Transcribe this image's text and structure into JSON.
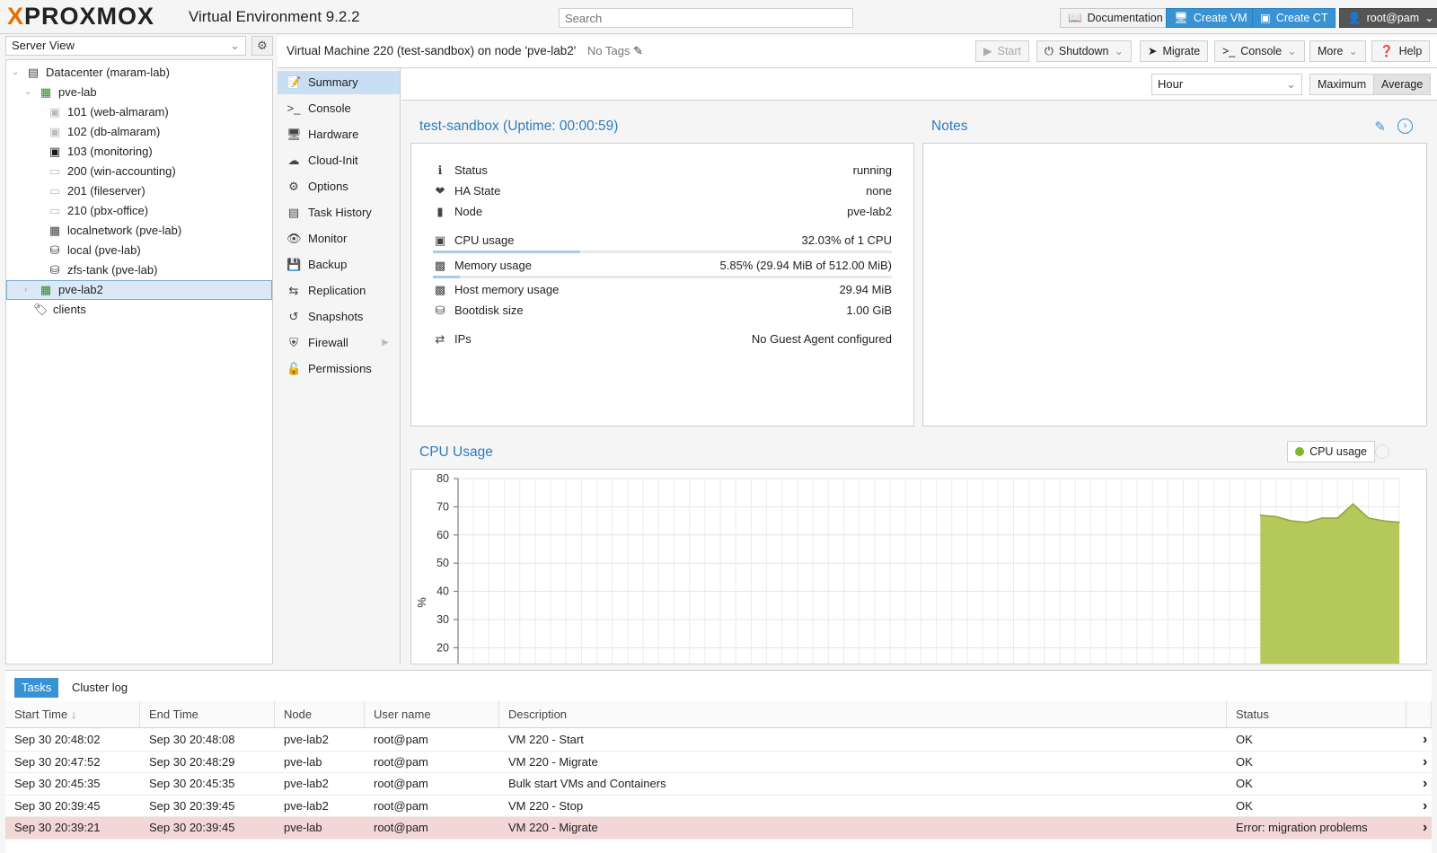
{
  "header": {
    "logo_prefix": "X",
    "logo_text": "PROXMOX",
    "version": "Virtual Environment 9.2.2",
    "search_placeholder": "Search",
    "buttons": {
      "documentation": "Documentation",
      "create_vm": "Create VM",
      "create_ct": "Create CT",
      "user": "root@pam"
    }
  },
  "sidebar": {
    "view_select": "Server View",
    "tree": [
      {
        "label": "Datacenter (maram-lab)",
        "icon": "datacenter-icon"
      },
      {
        "label": "pve-lab",
        "icon": "node-online-icon"
      },
      {
        "label": "101 (web-almaram)",
        "icon": "container-stopped-icon"
      },
      {
        "label": "102 (db-almaram)",
        "icon": "container-stopped-icon"
      },
      {
        "label": "103 (monitoring)",
        "icon": "container-running-icon"
      },
      {
        "label": "200 (win-accounting)",
        "icon": "vm-stopped-icon"
      },
      {
        "label": "201 (fileserver)",
        "icon": "vm-stopped-icon"
      },
      {
        "label": "210 (pbx-office)",
        "icon": "vm-stopped-icon"
      },
      {
        "label": "localnetwork (pve-lab)",
        "icon": "network-grid-icon"
      },
      {
        "label": "local (pve-lab)",
        "icon": "storage-icon"
      },
      {
        "label": "zfs-tank (pve-lab)",
        "icon": "storage-icon"
      },
      {
        "label": "pve-lab2",
        "icon": "node-online-icon"
      },
      {
        "label": "clients",
        "icon": "tags-icon"
      }
    ]
  },
  "titlebar": {
    "title": "Virtual Machine 220 (test-sandbox) on node 'pve-lab2'",
    "tags": "No Tags",
    "buttons": {
      "start": "Start",
      "shutdown": "Shutdown",
      "migrate": "Migrate",
      "console": "Console",
      "more": "More",
      "help": "Help"
    }
  },
  "nav": [
    {
      "label": "Summary",
      "icon": "summary-icon"
    },
    {
      "label": "Console",
      "icon": "console-icon"
    },
    {
      "label": "Hardware",
      "icon": "hardware-icon"
    },
    {
      "label": "Cloud-Init",
      "icon": "cloud-icon"
    },
    {
      "label": "Options",
      "icon": "options-gear-icon"
    },
    {
      "label": "Task History",
      "icon": "task-history-icon"
    },
    {
      "label": "Monitor",
      "icon": "monitor-eye-icon"
    },
    {
      "label": "Backup",
      "icon": "backup-floppy-icon"
    },
    {
      "label": "Replication",
      "icon": "replication-icon"
    },
    {
      "label": "Snapshots",
      "icon": "snapshots-icon"
    },
    {
      "label": "Firewall",
      "icon": "firewall-shield-icon"
    },
    {
      "label": "Permissions",
      "icon": "permissions-unlock-icon"
    }
  ],
  "toolbar2": {
    "timeframe": "Hour",
    "maximum": "Maximum",
    "average": "Average"
  },
  "summary": {
    "title": "test-sandbox (Uptime: 00:00:59)",
    "rows": {
      "status": {
        "label": "Status",
        "value": "running"
      },
      "ha": {
        "label": "HA State",
        "value": "none"
      },
      "node": {
        "label": "Node",
        "value": "pve-lab2"
      },
      "cpu": {
        "label": "CPU usage",
        "value": "32.03% of 1 CPU"
      },
      "mem": {
        "label": "Memory usage",
        "value": "5.85% (29.94 MiB of 512.00 MiB)"
      },
      "hostmem": {
        "label": "Host memory usage",
        "value": "29.94 MiB"
      },
      "bootdisk": {
        "label": "Bootdisk size",
        "value": "1.00 GiB"
      },
      "ips": {
        "label": "IPs",
        "value": "No Guest Agent configured"
      }
    },
    "cpu_fraction": 0.3203,
    "mem_fraction": 0.0585
  },
  "notes": {
    "title": "Notes"
  },
  "chart_data": {
    "type": "area",
    "title": "CPU Usage",
    "ylabel": "%",
    "ylim": [
      20,
      80
    ],
    "yticks": [
      "80",
      "70",
      "60",
      "50",
      "40",
      "30",
      "20"
    ],
    "legend": "CPU usage",
    "legend_position": "top-right",
    "grid": true,
    "color": "#b5c95a",
    "series": [
      {
        "name": "CPU usage",
        "x": [
          52,
          53,
          54,
          55,
          56,
          57,
          58,
          59,
          60,
          61
        ],
        "values": [
          67,
          66.5,
          65,
          64.5,
          66,
          66,
          71,
          66,
          65,
          64.5
        ]
      }
    ],
    "xlim": [
      0,
      61
    ]
  },
  "bottom": {
    "tabs": {
      "tasks": "Tasks",
      "cluster_log": "Cluster log"
    },
    "columns": [
      "Start Time",
      "End Time",
      "Node",
      "User name",
      "Description",
      "Status"
    ],
    "rows": [
      {
        "start": "Sep 30 20:48:02",
        "end": "Sep 30 20:48:08",
        "node": "pve-lab2",
        "user": "root@pam",
        "desc": "VM 220 - Start",
        "status": "OK"
      },
      {
        "start": "Sep 30 20:47:52",
        "end": "Sep 30 20:48:29",
        "node": "pve-lab",
        "user": "root@pam",
        "desc": "VM 220 - Migrate",
        "status": "OK"
      },
      {
        "start": "Sep 30 20:45:35",
        "end": "Sep 30 20:45:35",
        "node": "pve-lab2",
        "user": "root@pam",
        "desc": "Bulk start VMs and Containers",
        "status": "OK"
      },
      {
        "start": "Sep 30 20:39:45",
        "end": "Sep 30 20:39:45",
        "node": "pve-lab2",
        "user": "root@pam",
        "desc": "VM 220 - Stop",
        "status": "OK"
      },
      {
        "start": "Sep 30 20:39:21",
        "end": "Sep 30 20:39:45",
        "node": "pve-lab",
        "user": "root@pam",
        "desc": "VM 220 - Migrate",
        "status": "Error: migration problems"
      }
    ]
  }
}
